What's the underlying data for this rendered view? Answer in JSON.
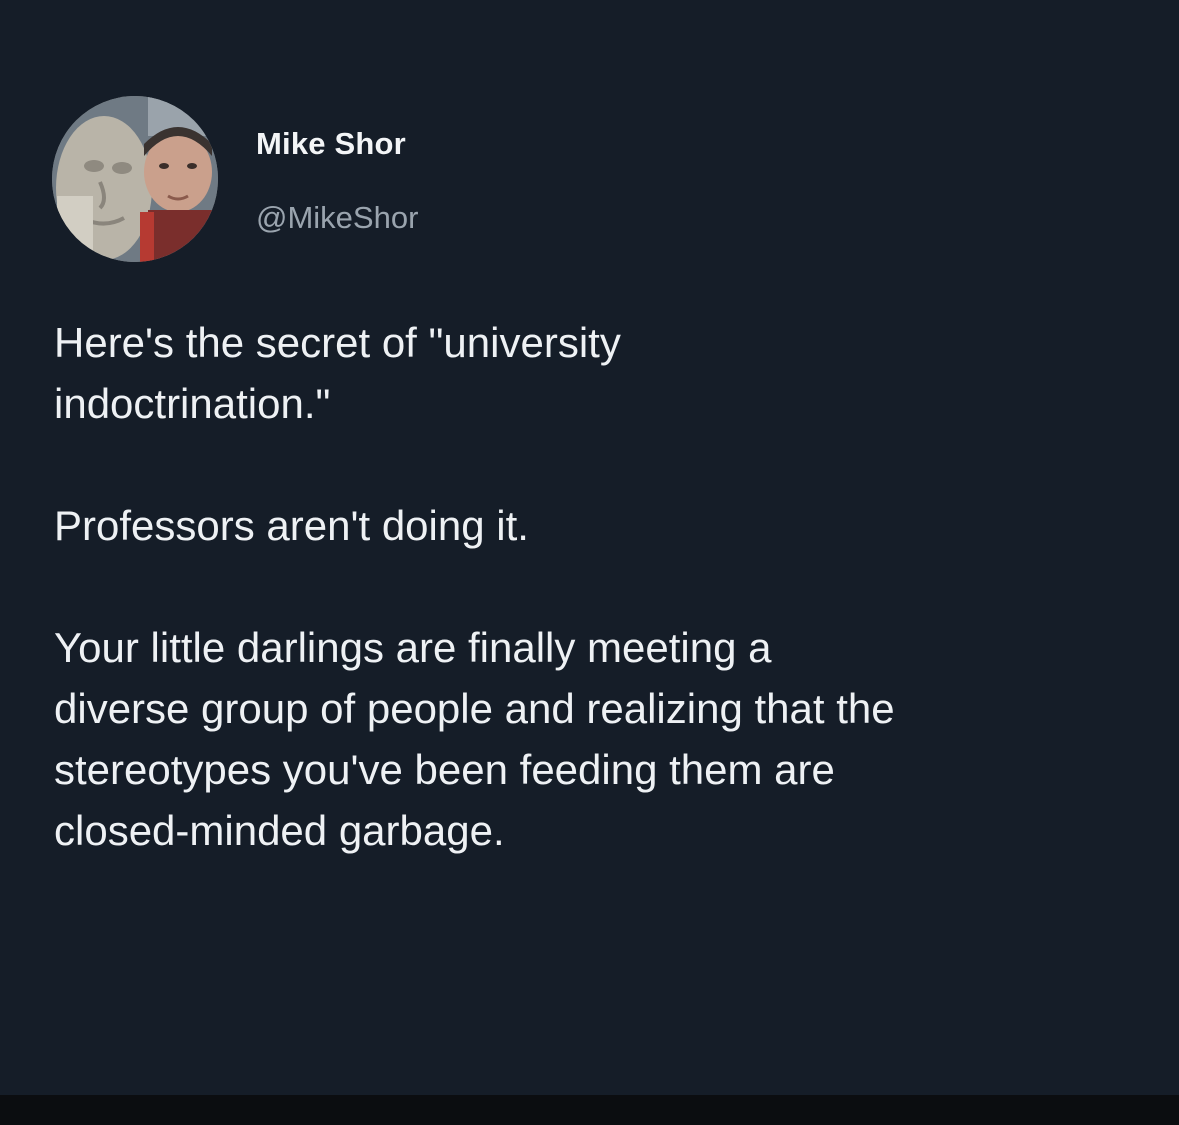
{
  "tweet": {
    "author": {
      "display_name": "Mike Shor",
      "handle": "@MikeShor",
      "avatar_icon": "profile-photo"
    },
    "paragraphs": [
      "Here's the secret of \"university\nindoctrination.\"",
      "Professors aren't doing it.",
      "Your little darlings are finally meeting a\ndiverse group of people and realizing that the\nstereotypes you've been feeding them are\nclosed-minded garbage."
    ]
  },
  "colors": {
    "background": "#151d28",
    "text": "#eef1f4",
    "handle": "#9aa4ae",
    "bottom_bar": "#0b0d10"
  }
}
